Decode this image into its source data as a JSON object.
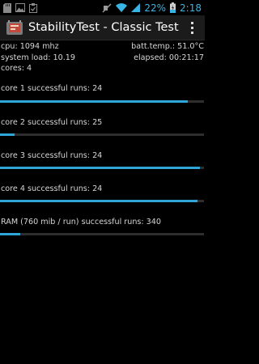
{
  "status_bar": {
    "battery": "22%",
    "time": "2:18",
    "icons": [
      "sd-card-icon",
      "image-icon",
      "clipboard-check-icon",
      "mute-icon",
      "wifi-icon",
      "signal-icon",
      "battery-charging-icon"
    ],
    "accent": "#3ab4e4"
  },
  "app": {
    "title": "StabilityTest - Classic Test",
    "icon": "app-icon",
    "menu_icon": "overflow-menu-icon"
  },
  "info": {
    "cpu": "cpu: 1094 mhz",
    "batt_temp": "batt.temp.: 51.0°C",
    "system_load": "system load: 10.19",
    "elapsed": "elapsed: 00:21:17",
    "cores": "cores: 4"
  },
  "tests": [
    {
      "label": "core 1 successful runs: 24",
      "progress": 0.92
    },
    {
      "label": "core 2 successful runs: 25",
      "progress": 0.07
    },
    {
      "label": "core 3 successful runs: 24",
      "progress": 0.98
    },
    {
      "label": "core 4 successful runs: 24",
      "progress": 0.97
    },
    {
      "label": "RAM (760 mib / run) successful runs: 340",
      "progress": 0.1
    }
  ],
  "colors": {
    "progress_fill": "#2fa5d8",
    "progress_track": "#2e2e2e",
    "action_bar": "#1b1b1b"
  }
}
